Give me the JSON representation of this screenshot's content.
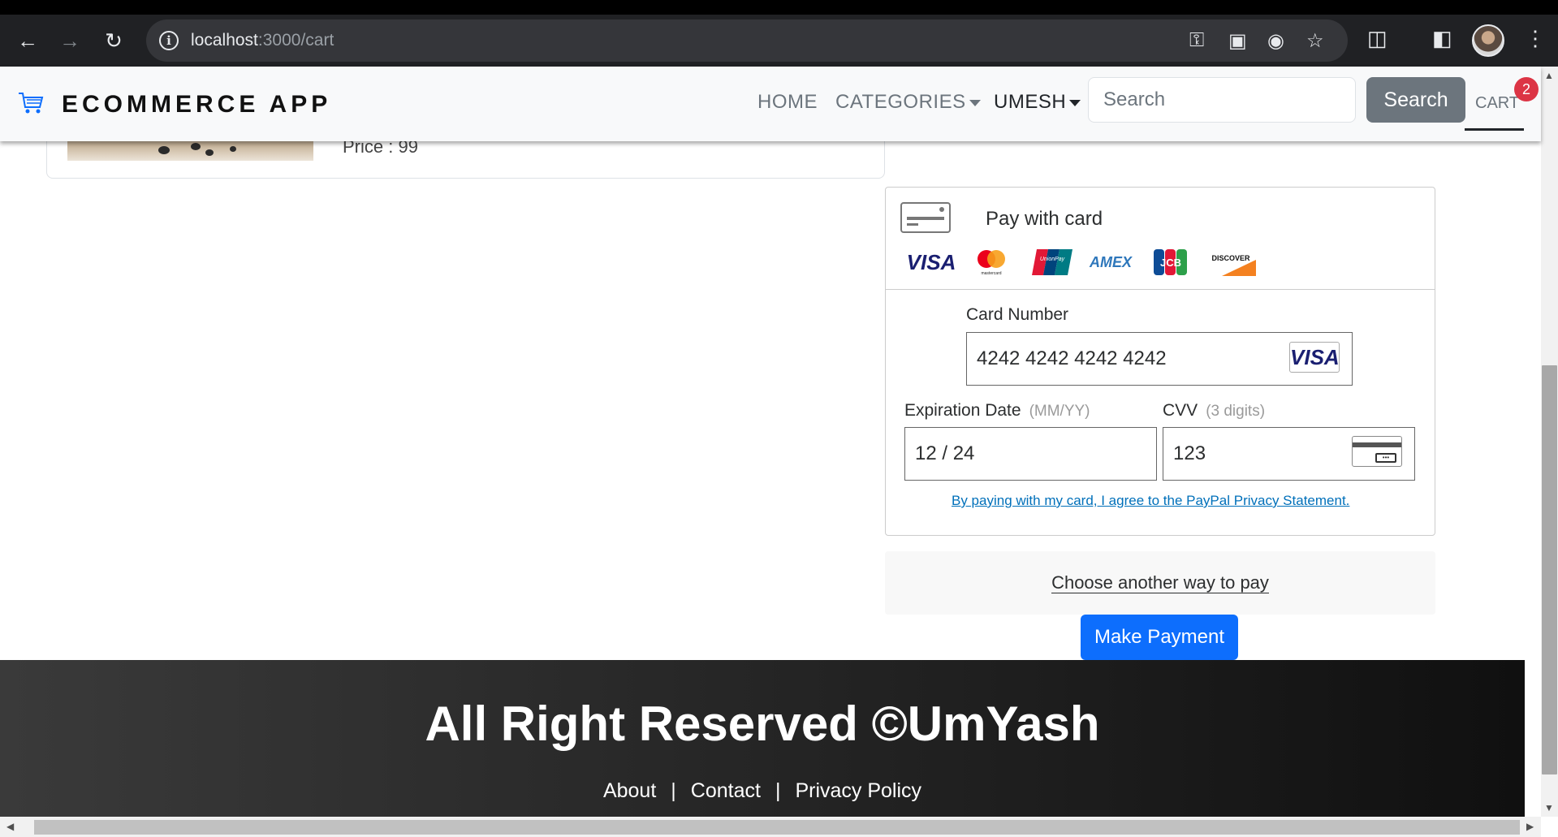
{
  "browser": {
    "url_host": "localhost",
    "url_path": ":3000/cart"
  },
  "navbar": {
    "brand": "ECOMMERCE APP",
    "links": {
      "home": "HOME",
      "categories": "CATEGORIES",
      "user": "UMESH"
    },
    "search_placeholder": "Search",
    "search_button": "Search",
    "cart_label": "CART",
    "cart_count": "2"
  },
  "product": {
    "price_text": "Price : 99"
  },
  "payment": {
    "title": "Pay with card",
    "card_brands": [
      "VISA",
      "mastercard",
      "UnionPay",
      "AMEX",
      "JCB",
      "DISCOVER"
    ],
    "card_number_label": "Card Number",
    "card_number_value": "4242 4242 4242 4242",
    "card_detected": "VISA",
    "expiry_label": "Expiration Date",
    "expiry_hint": "(MM/YY)",
    "expiry_value": "12 / 24",
    "cvv_label": "CVV",
    "cvv_hint": "(3 digits)",
    "cvv_value": "123",
    "privacy_text": "By paying with my card, I agree to the PayPal Privacy Statement.",
    "alt_pay": "Choose another way to pay",
    "make_payment": "Make Payment"
  },
  "footer": {
    "title": "All Right Reserved ©UmYash",
    "links": {
      "about": "About",
      "contact": "Contact",
      "privacy": "Privacy Policy"
    },
    "separator": "|"
  },
  "colors": {
    "primary": "#0d6efd",
    "secondary": "#6c757d",
    "badge": "#dc3545",
    "paypal_link": "#0070ba"
  }
}
